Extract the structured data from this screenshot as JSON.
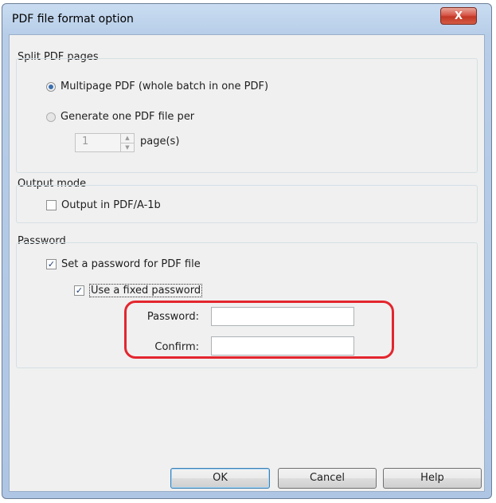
{
  "window": {
    "title": "PDF file format option",
    "close_label": "X"
  },
  "split_pages": {
    "group_label": "Split PDF pages",
    "multipage_label": "Multipage PDF (whole batch in one PDF)",
    "multipage_selected": true,
    "per_file_label": "Generate one PDF file per",
    "pages_value": "1",
    "pages_unit": "page(s)"
  },
  "output_mode": {
    "group_label": "Output mode",
    "pdfa_label": "Output in PDF/A-1b",
    "pdfa_checked": false
  },
  "password": {
    "group_label": "Password",
    "set_password_label": "Set a password for PDF file",
    "set_password_checked": true,
    "fixed_password_label": "Use a fixed password",
    "fixed_password_checked": true,
    "password_label": "Password:",
    "password_value": "",
    "confirm_label": "Confirm:",
    "confirm_value": ""
  },
  "buttons": {
    "ok": "OK",
    "cancel": "Cancel",
    "help": "Help"
  },
  "colors": {
    "highlight": "#e3262e",
    "accent": "#3a6fb0"
  },
  "icons": {
    "checkmark": "checkmark-icon",
    "spin_up": "chevron-up-icon",
    "spin_down": "chevron-down-icon"
  }
}
